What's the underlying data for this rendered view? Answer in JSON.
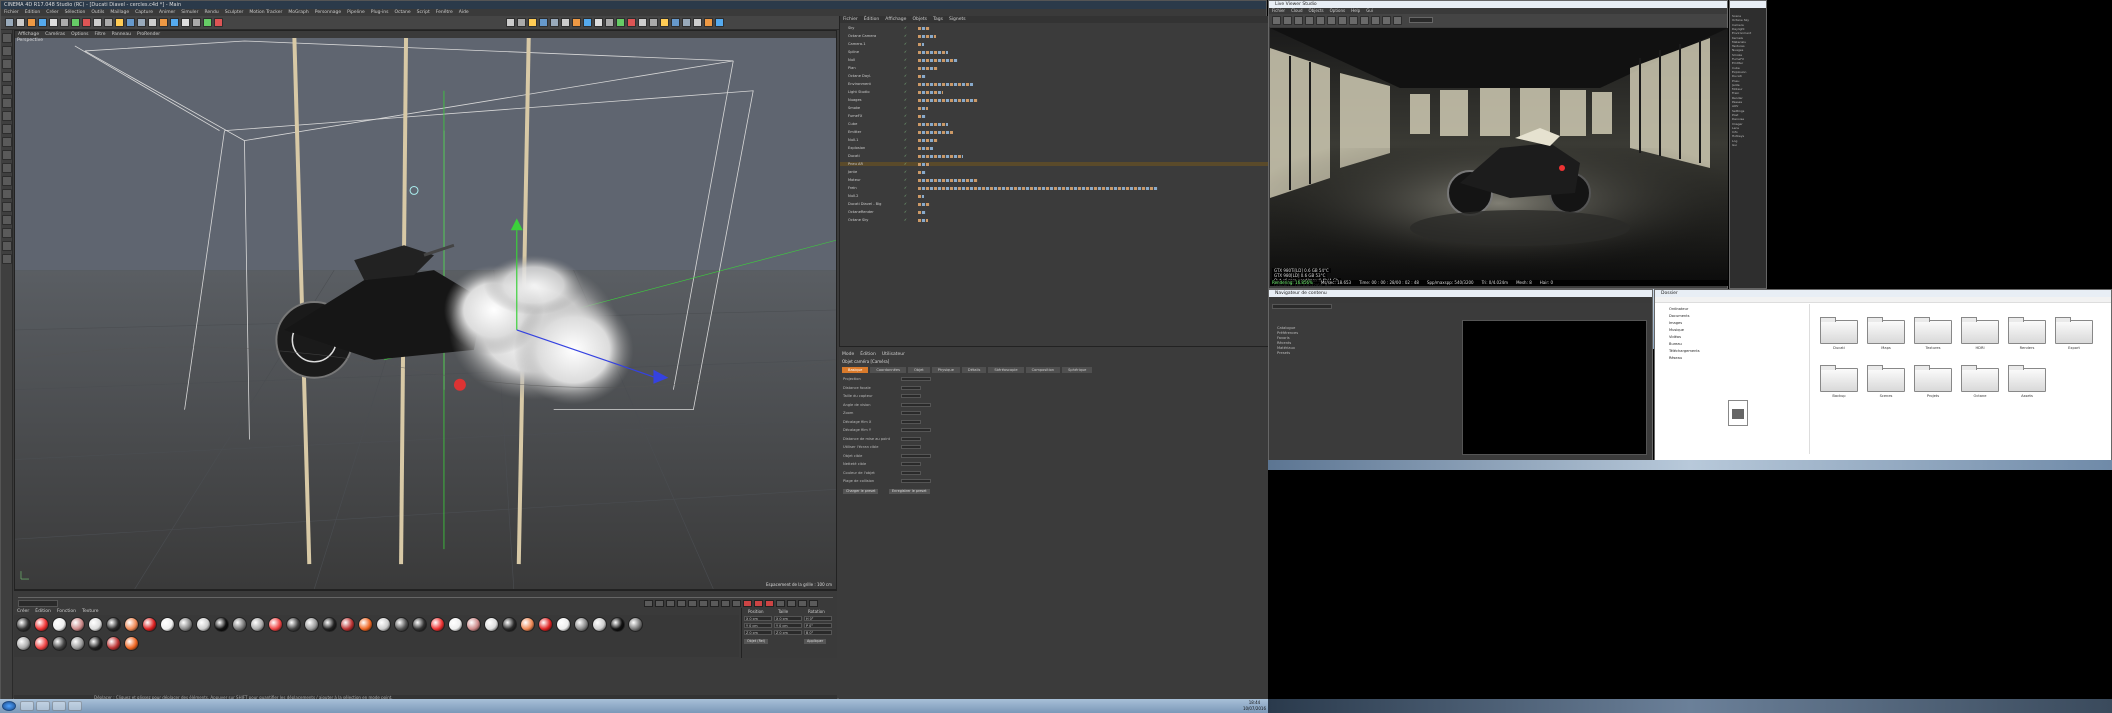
{
  "c4d": {
    "title": "CINEMA 4D R17.048 Studio (RC) - [Ducati Diavel - cercles.c4d *] - Main",
    "menu": [
      "Fichier",
      "Édition",
      "Créer",
      "Sélection",
      "Outils",
      "Maillage",
      "Capture",
      "Animer",
      "Simuler",
      "Rendu",
      "Sculpter",
      "Motion Tracker",
      "MoGraph",
      "Personnage",
      "Pipeline",
      "Plug-ins",
      "Octane",
      "Script",
      "Fenêtre",
      "Aide"
    ],
    "viewport_menu": [
      "Affichage",
      "Caméras",
      "Options",
      "Filtre",
      "Panneau",
      "ProRender"
    ],
    "viewport_label": "Perspective",
    "grid_note": "Espacement de la grille : 100 cm",
    "mat_menu": [
      "Créer",
      "Édition",
      "Fonction",
      "Texture"
    ],
    "status": "Déplacer : Cliquez et glissez pour déplacer des éléments. Appuyer sur SHIFT pour quantifier les déplacements / ajouter à la sélection en mode point.",
    "coords": {
      "headers": [
        "Position",
        "Taille",
        "Rotation"
      ],
      "rows": [
        [
          "X 0 cm",
          "X 0 cm",
          "H 0°"
        ],
        [
          "Y 0 cm",
          "Y 0 cm",
          "P 0°"
        ],
        [
          "Z 0 cm",
          "Z 0 cm",
          "B 0°"
        ]
      ],
      "mode": "Objet (Rel)",
      "apply": "Appliquer"
    }
  },
  "object_manager": {
    "menu": [
      "Fichier",
      "Édition",
      "Affichage",
      "Objets",
      "Tags",
      "Signets"
    ],
    "rows": [
      "Sky",
      "Octane Camera",
      "Camera.1",
      "Spline",
      "Null",
      "Plan",
      "Octane Dayl.",
      "Environment",
      "Light Studio",
      "Nuages",
      "Smoke",
      "FumeFX",
      "Cube",
      "Emitter",
      "Null.1",
      "Explosion",
      "Ducati",
      "Pneu AR",
      "Jante",
      "Moteur",
      "Frein",
      "Null.2",
      "Ducati Diavel - Big",
      "OctaneRender",
      "Octane Sky"
    ]
  },
  "attributes": {
    "menu": [
      "Mode",
      "Édition",
      "Utilisateur"
    ],
    "title": "Objet caméra [Caméra]",
    "tabs": [
      "Basique",
      "Coordonnées",
      "Objet",
      "Physique",
      "Détails",
      "Stéréoscopie",
      "Composition",
      "Sphérique"
    ],
    "fields": [
      "Projection",
      "Distance focale",
      "Taille du capteur",
      "Angle de vision",
      "Zoom",
      "Décalage film X",
      "Décalage film Y",
      "Distance de mise au point",
      "Utiliser l'écran cible",
      "Objet cible",
      "Netteté cible",
      "Couleur de l'objet",
      "Plage de collision"
    ],
    "buttons": [
      "Charger le preset",
      "Enregistrer le preset"
    ]
  },
  "picture_viewer": {
    "title": "Live Viewer Studio",
    "menu": [
      "Fichier",
      "Cloud",
      "Objects",
      "Options",
      "Help",
      "Gui"
    ],
    "stats": [
      "GTX 980Ti[LD]  0.6 GB  54°C",
      "GTX 980[LD]    0.6 GB  53°C",
      "Out-of-core used/max:0 Kb/4 Gb",
      "Grey8/16: 0/0    Rgb32/64: 0/1",
      "Used/free/total vram: 1.267Gb/5.134Gb/6Gb"
    ],
    "render_bar": [
      "Rendering: 16.856%",
      "Ms/sec: 18.653",
      "Time: 00 : 00 : 28/00 : 02 : 48",
      "Spp/maxspp: 540/3200",
      "Tri: 0/4.024m",
      "Mesh: 8",
      "Hair: 0"
    ]
  },
  "side_panel": {
    "items": [
      "Scene",
      "Octane Sky",
      "Camera",
      "Daylight",
      "Environment",
      "Kernels",
      "Materials",
      "Textures",
      "Nuages",
      "Smoke",
      "FumeFX",
      "Emitter",
      "Cube",
      "Explosion",
      "Ducati",
      "Pneu",
      "Jante",
      "Moteur",
      "Frein",
      "Render",
      "Passes",
      "AOV",
      "Settings",
      "Post",
      "Denoise",
      "Imager",
      "Lens",
      "Info",
      "Hotkeys",
      "Log",
      "Gui"
    ]
  },
  "content_browser": {
    "title": "Navigateur de contenu",
    "tree": [
      "Catalogue",
      "Préférences",
      "Favoris",
      "Récents",
      "Matériaux",
      "Presets"
    ]
  },
  "explorer": {
    "title": "Dossier",
    "tree": [
      "Ordinateur",
      "Documents",
      "Images",
      "Musique",
      "Vidéos",
      "Bureau",
      "Téléchargements",
      "Réseau"
    ],
    "folders": [
      "Ducati",
      "Maps",
      "Textures",
      "HDRI",
      "Renders",
      "Export",
      "Backup",
      "Scenes",
      "Projets",
      "Octane",
      "Assets"
    ]
  },
  "taskbar": {
    "time": "18:44",
    "date": "10/07/2016"
  },
  "colors": {
    "accent": "#d97a2b",
    "bg": "#3b3b3b",
    "viewport": "#4a4f57"
  }
}
